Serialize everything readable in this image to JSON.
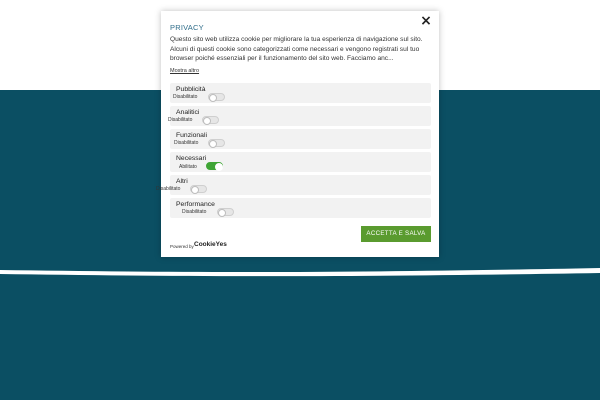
{
  "modal": {
    "title": "PRIVACY",
    "description": "Questo sito web utilizza cookie per migliorare la tua esperienza di navigazione sul sito. Alcuni di questi cookie sono categorizzati come necessari e vengono registrati sul tuo browser poiché essenziali per il funzionamento del sito web. Facciamo anc...",
    "more_link": "Mostra altro",
    "close_label": "×",
    "categories": [
      {
        "name": "Pubblicità",
        "state": "Disabilitato",
        "enabled": false
      },
      {
        "name": "Analitici",
        "state": "Disabilitato",
        "enabled": false
      },
      {
        "name": "Funzionali",
        "state": "Disabilitato",
        "enabled": false
      },
      {
        "name": "Necessari",
        "state": "Abilitato",
        "enabled": true
      },
      {
        "name": "Altri",
        "state": "Disabilitato",
        "enabled": false
      },
      {
        "name": "Performance",
        "state": "Disabilitato",
        "enabled": false
      }
    ],
    "accept_label": "ACCETTA E SALVA",
    "powered_by": "Powered by",
    "brand": "CookieYes"
  },
  "colors": {
    "background_dark": "#0b4f63",
    "accent_green": "#5a9b2f",
    "title_blue": "#2f6d8a"
  }
}
